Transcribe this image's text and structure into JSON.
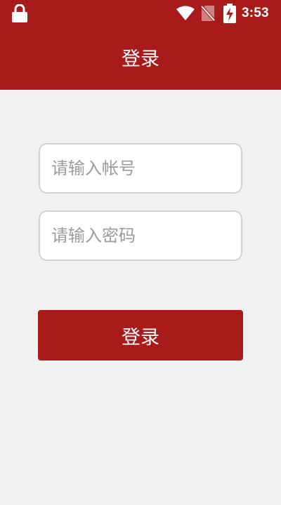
{
  "status_bar": {
    "time": "3:53",
    "icons": [
      "lock-icon",
      "wifi-icon",
      "no-sim-icon",
      "battery-charging-icon"
    ]
  },
  "header": {
    "title": "登录"
  },
  "form": {
    "account_placeholder": "请输入帐号",
    "password_placeholder": "请输入密码",
    "login_label": "登录"
  },
  "colors": {
    "brand": "#a91b1b",
    "background": "#f1f1f1",
    "field_border": "#d2d2d2",
    "placeholder": "#9b9b9b"
  }
}
